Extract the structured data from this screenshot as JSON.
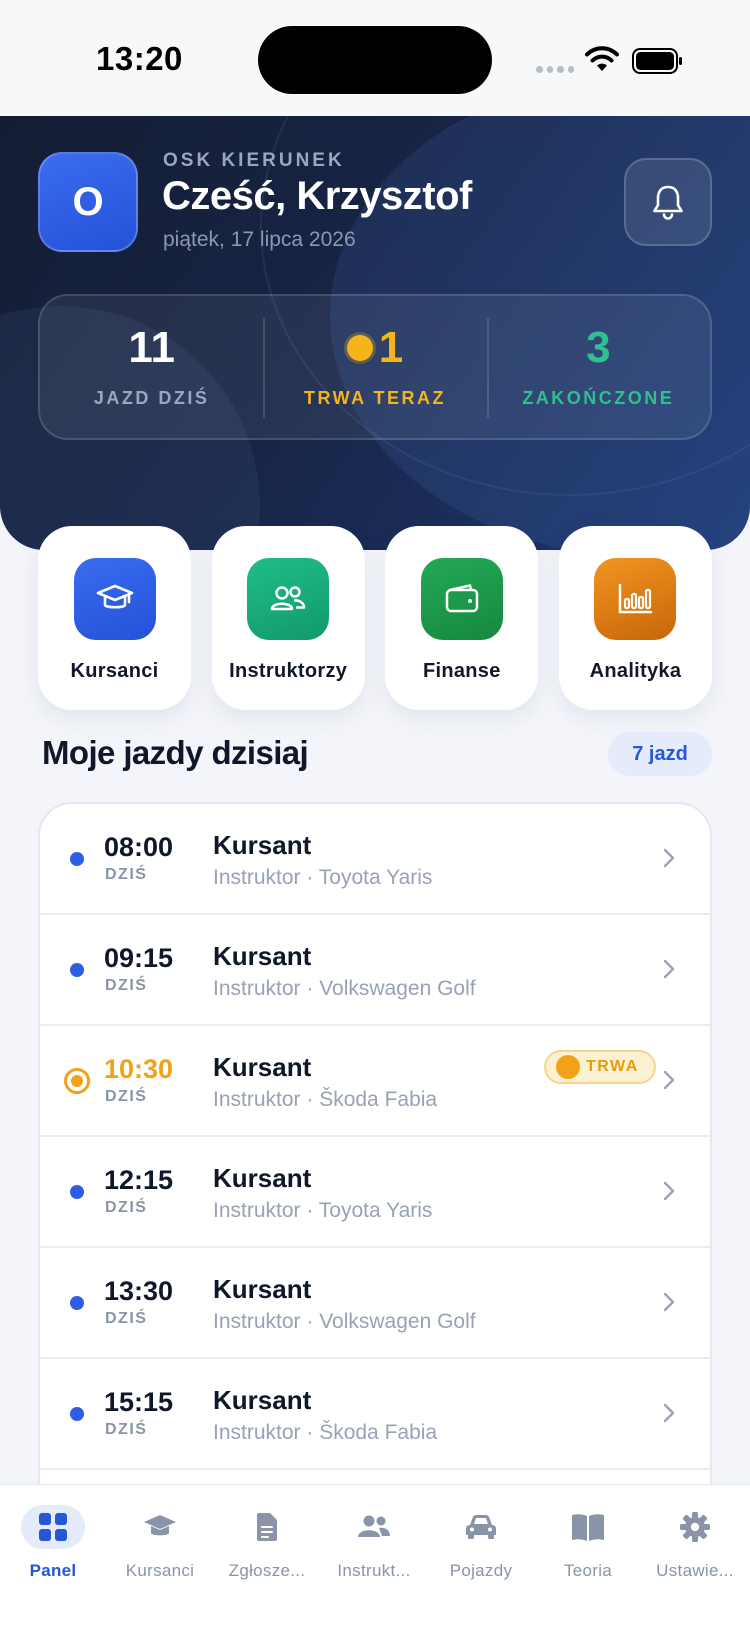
{
  "status_bar": {
    "time": "13:20"
  },
  "header": {
    "logo_letter": "O",
    "school_name": "OSK KIERUNEK",
    "greeting": "Cześć, Krzysztof",
    "date": "piątek, 17 lipca 2026"
  },
  "stats": [
    {
      "value": "11",
      "label": "JAZD DZIŚ",
      "color": "#ffffff",
      "label_color": "#9aa7bf"
    },
    {
      "value": "1",
      "label": "TRWA TERAZ",
      "color": "#f5b41c",
      "label_color": "#f5b41c"
    },
    {
      "value": "3",
      "label": "ZAKOŃCZONE",
      "color": "#2fc08f",
      "label_color": "#2fc08f"
    }
  ],
  "quick_actions": [
    {
      "label": "Kursanci",
      "icon": "graduation-cap-icon",
      "color": "#2f5ee3"
    },
    {
      "label": "Instruktorzy",
      "icon": "users-icon",
      "color": "#16a877"
    },
    {
      "label": "Finanse",
      "icon": "wallet-icon",
      "color": "#1d9a48"
    },
    {
      "label": "Analityka",
      "icon": "bar-chart-icon",
      "color": "#e37e0f"
    }
  ],
  "section": {
    "title": "Moje jazdy dzisiaj",
    "count": "7 jazd"
  },
  "rides": [
    {
      "time": "08:00",
      "day": "DZIŚ",
      "name": "Kursant",
      "subtitle": "Instruktor · Toyota Yaris"
    },
    {
      "time": "09:15",
      "day": "DZIŚ",
      "name": "Kursant",
      "subtitle": "Instruktor · Volkswagen Golf"
    },
    {
      "time": "10:30",
      "day": "DZIŚ",
      "name": "Kursant",
      "subtitle": "Instruktor · Škoda Fabia",
      "badge": "TRWA"
    },
    {
      "time": "12:15",
      "day": "DZIŚ",
      "name": "Kursant",
      "subtitle": "Instruktor · Toyota Yaris"
    },
    {
      "time": "13:30",
      "day": "DZIŚ",
      "name": "Kursant",
      "subtitle": "Instruktor · Volkswagen Golf"
    },
    {
      "time": "15:15",
      "day": "DZIŚ",
      "name": "Kursant",
      "subtitle": "Instruktor · Škoda Fabia"
    }
  ],
  "tabs": [
    {
      "label": "Panel",
      "icon": "grid-icon"
    },
    {
      "label": "Kursanci",
      "icon": "graduation-cap-icon"
    },
    {
      "label": "Zgłosze...",
      "icon": "document-icon"
    },
    {
      "label": "Instrukt...",
      "icon": "users-icon"
    },
    {
      "label": "Pojazdy",
      "icon": "car-icon"
    },
    {
      "label": "Teoria",
      "icon": "book-icon"
    },
    {
      "label": "Ustawie...",
      "icon": "gear-icon"
    }
  ],
  "colors": {
    "accent": "#2f5ee3",
    "live": "#f3a116",
    "success": "#2fc08f"
  }
}
